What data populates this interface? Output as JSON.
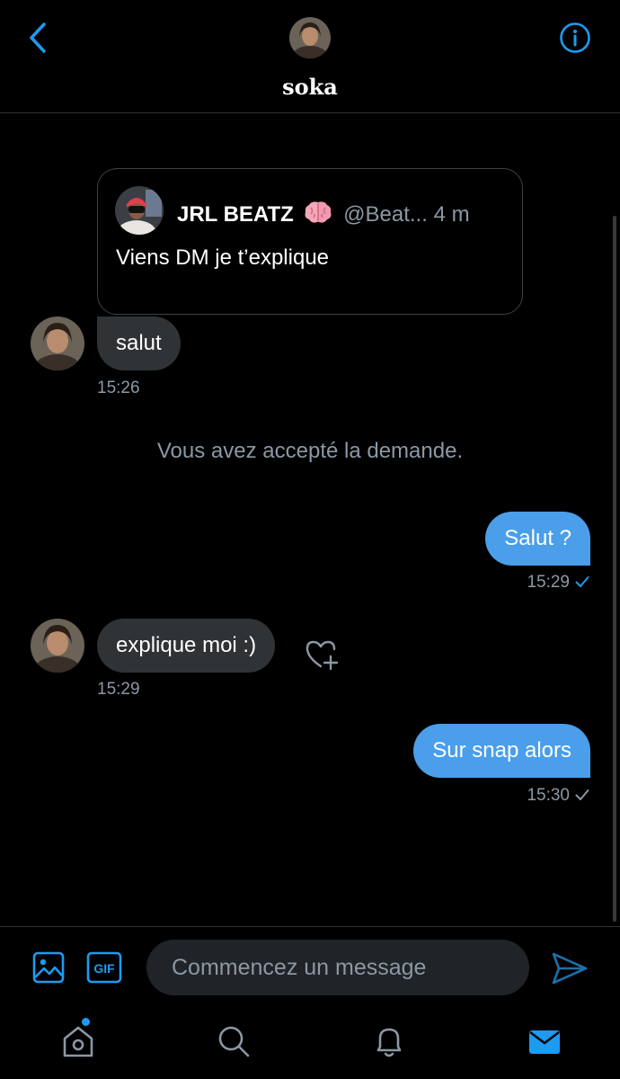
{
  "header": {
    "title": "soka",
    "back_icon": "chevron-left-icon",
    "info_icon": "info-circle-icon"
  },
  "shared_tweet": {
    "author": "JRL BEATZ",
    "emoji": "brain-emoji",
    "handle": "@Beat...",
    "time": "4 m",
    "text": "Viens DM je t’explique"
  },
  "messages": [
    {
      "direction": "incoming",
      "text": "salut",
      "time": "15:26"
    },
    {
      "direction": "system",
      "text": "Vous avez accepté la demande."
    },
    {
      "direction": "outgoing",
      "text": "Salut ?",
      "time": "15:29",
      "status": "seen"
    },
    {
      "direction": "incoming",
      "text": "explique moi :)",
      "time": "15:29"
    },
    {
      "direction": "outgoing",
      "text": "Sur snap alors",
      "time": "15:30",
      "status": "sent"
    }
  ],
  "composer": {
    "placeholder": "Commencez un message",
    "value": "",
    "gif_label": "GIF"
  },
  "tabbar": {
    "items": [
      "home-icon",
      "search-icon",
      "bell-icon",
      "mail-icon"
    ],
    "active": "mail-icon",
    "home_has_notification": true
  },
  "colors": {
    "background": "#000000",
    "accent": "#1d9bf0",
    "outgoing_bubble": "#4a9eea",
    "incoming_bubble": "#2f3336",
    "muted_text": "#8b98a5"
  }
}
